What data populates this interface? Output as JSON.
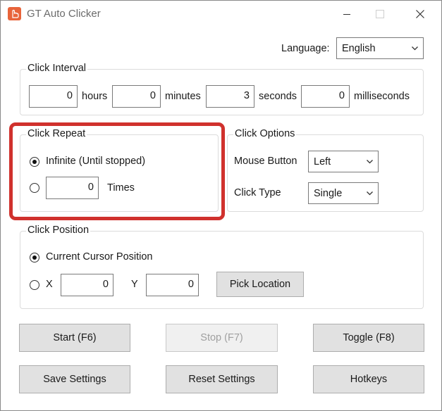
{
  "window": {
    "title": "GT Auto Clicker"
  },
  "language": {
    "label": "Language:",
    "value": "English"
  },
  "interval": {
    "title": "Click Interval",
    "hours": "0",
    "hours_label": "hours",
    "minutes": "0",
    "minutes_label": "minutes",
    "seconds": "3",
    "seconds_label": "seconds",
    "ms": "0",
    "ms_label": "milliseconds"
  },
  "repeat": {
    "title": "Click Repeat",
    "infinite_label": "Infinite (Until stopped)",
    "times_value": "0",
    "times_label": "Times",
    "selected": "infinite"
  },
  "options": {
    "title": "Click Options",
    "mouse_button_label": "Mouse Button",
    "mouse_button_value": "Left",
    "click_type_label": "Click Type",
    "click_type_value": "Single"
  },
  "position": {
    "title": "Click Position",
    "current_label": "Current Cursor Position",
    "x_label": "X",
    "x_value": "0",
    "y_label": "Y",
    "y_value": "0",
    "pick_label": "Pick Location",
    "selected": "current"
  },
  "buttons": {
    "start": "Start (F6)",
    "stop": "Stop (F7)",
    "toggle": "Toggle (F8)",
    "save": "Save Settings",
    "reset": "Reset Settings",
    "hotkeys": "Hotkeys"
  },
  "colors": {
    "highlight": "#d0312d",
    "app_icon": "#e8643a"
  }
}
